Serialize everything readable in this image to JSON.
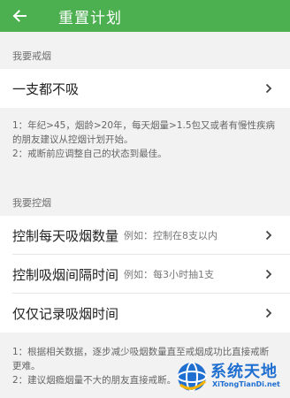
{
  "header": {
    "title": "重置计划",
    "back_icon": "arrow-left-icon",
    "background_color": "#4caf50"
  },
  "section_quit": {
    "title": "我要戒烟",
    "item": {
      "label": "一支都不吸",
      "icon": "chevron-right-icon"
    },
    "notes": [
      "1：年纪>45，烟龄>20年，每天烟量>1.5包又或者有慢性疾病的朋友建议从控烟计划开始。",
      "2：戒断前应调整自己的状态到最佳。"
    ]
  },
  "section_control": {
    "title": "我要控烟",
    "items": [
      {
        "label": "控制每天吸烟数量",
        "hint": "例如：控制在8支以内"
      },
      {
        "label": "控制吸烟间隔时间",
        "hint": "例如：每3小时抽1支"
      },
      {
        "label": "仅仅记录吸烟时间",
        "hint": ""
      }
    ],
    "notes": [
      "1：根据相关数据，逐步减少吸烟数量直至戒烟成功比直接戒断更难。",
      "2：建议烟瘾烟量不大的朋友直接戒断。"
    ]
  },
  "watermark": {
    "title": "系统天地",
    "subtitle": "XiTongTianDi.net"
  }
}
